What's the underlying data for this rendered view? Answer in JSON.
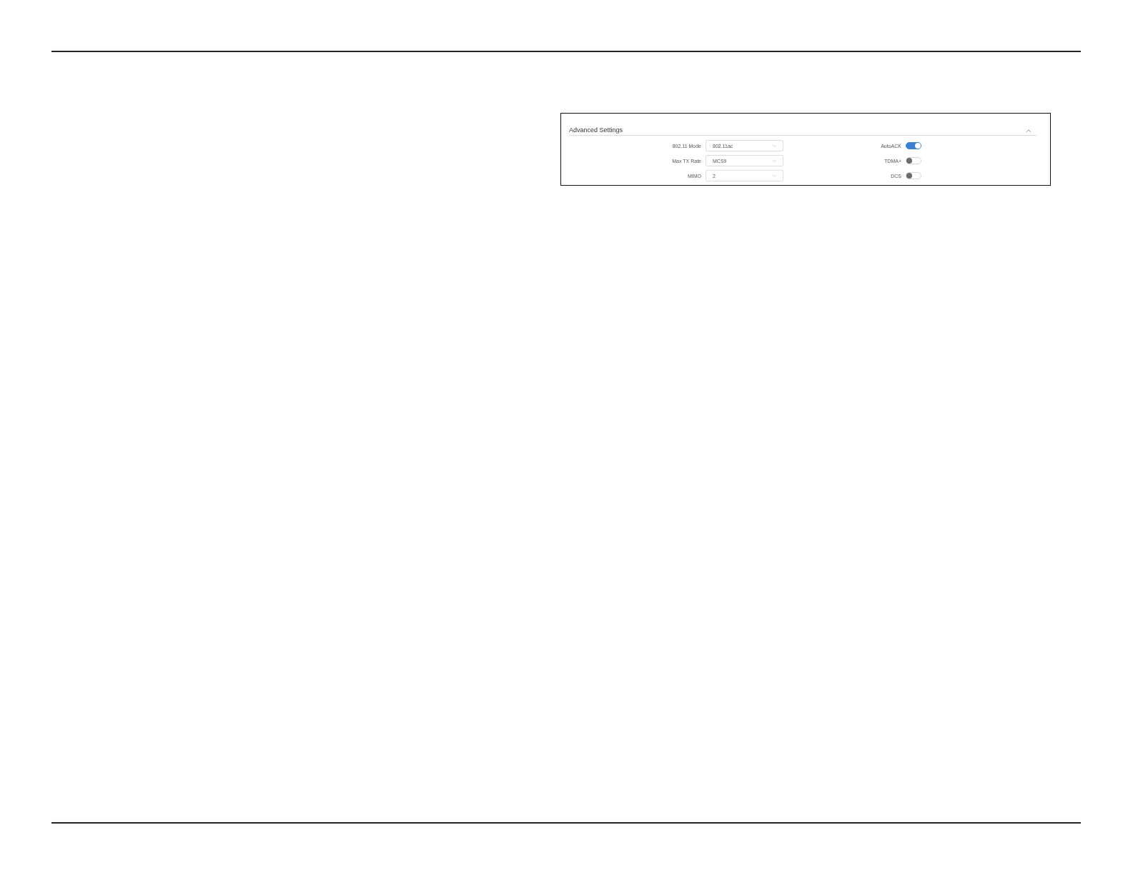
{
  "panel": {
    "title": "Advanced Settings",
    "expanded": true
  },
  "settings": [
    {
      "label": "802.11 Mode",
      "value": "802.11ac"
    },
    {
      "label": "Max TX Rate",
      "value": "MCS9"
    },
    {
      "label": "MIMO",
      "value": "2"
    }
  ],
  "switches": [
    {
      "label": "AutoACK",
      "on": true
    },
    {
      "label": "TDMA+",
      "on": false
    },
    {
      "label": "DCS",
      "on": false
    }
  ]
}
